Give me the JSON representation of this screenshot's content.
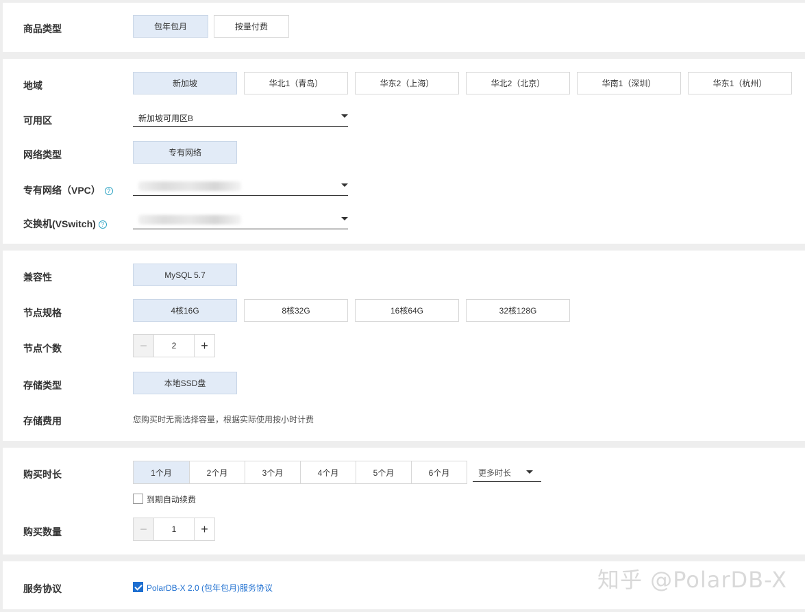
{
  "product_type": {
    "label": "商品类型",
    "options": [
      "包年包月",
      "按量付费"
    ],
    "selected": "包年包月"
  },
  "region": {
    "label": "地域",
    "options": [
      "新加坡",
      "华北1（青岛）",
      "华东2（上海）",
      "华北2（北京）",
      "华南1（深圳）",
      "华东1（杭州）"
    ],
    "selected": "新加坡"
  },
  "zone": {
    "label": "可用区",
    "value": "新加坡可用区B"
  },
  "network_type": {
    "label": "网络类型",
    "options": [
      "专有网络"
    ],
    "selected": "专有网络"
  },
  "vpc": {
    "label": "专有网络（VPC）",
    "help_icon": "question-circle-icon"
  },
  "vswitch": {
    "label": "交换机(VSwitch)",
    "help_icon": "question-circle-icon"
  },
  "compatibility": {
    "label": "兼容性",
    "options": [
      "MySQL 5.7"
    ],
    "selected": "MySQL 5.7"
  },
  "node_spec": {
    "label": "节点规格",
    "options": [
      "4核16G",
      "8核32G",
      "16核64G",
      "32核128G"
    ],
    "selected": "4核16G"
  },
  "node_count": {
    "label": "节点个数",
    "value": "2",
    "minus": "−",
    "plus": "+"
  },
  "storage_type": {
    "label": "存储类型",
    "options": [
      "本地SSD盘"
    ],
    "selected": "本地SSD盘"
  },
  "storage_fee": {
    "label": "存储费用",
    "note": "您购买时无需选择容量，根据实际使用按小时计费"
  },
  "duration": {
    "label": "购买时长",
    "options": [
      "1个月",
      "2个月",
      "3个月",
      "4个月",
      "5个月",
      "6个月"
    ],
    "selected": "1个月",
    "more_label": "更多时长",
    "auto_renew_label": "到期自动续费",
    "auto_renew_checked": false
  },
  "quantity": {
    "label": "购买数量",
    "value": "1",
    "minus": "−",
    "plus": "+"
  },
  "agreement": {
    "label": "服务协议",
    "text": "PolarDB-X 2.0 (包年包月)服务协议",
    "checked": true,
    "link_color": "#1e6fd0"
  },
  "watermark": "知乎 @PolarDB-X",
  "colors": {
    "selected_bg": "#e2ebf7",
    "border": "#d7d7d7",
    "accent": "#1e6fd0",
    "help": "#2fa4c4"
  }
}
